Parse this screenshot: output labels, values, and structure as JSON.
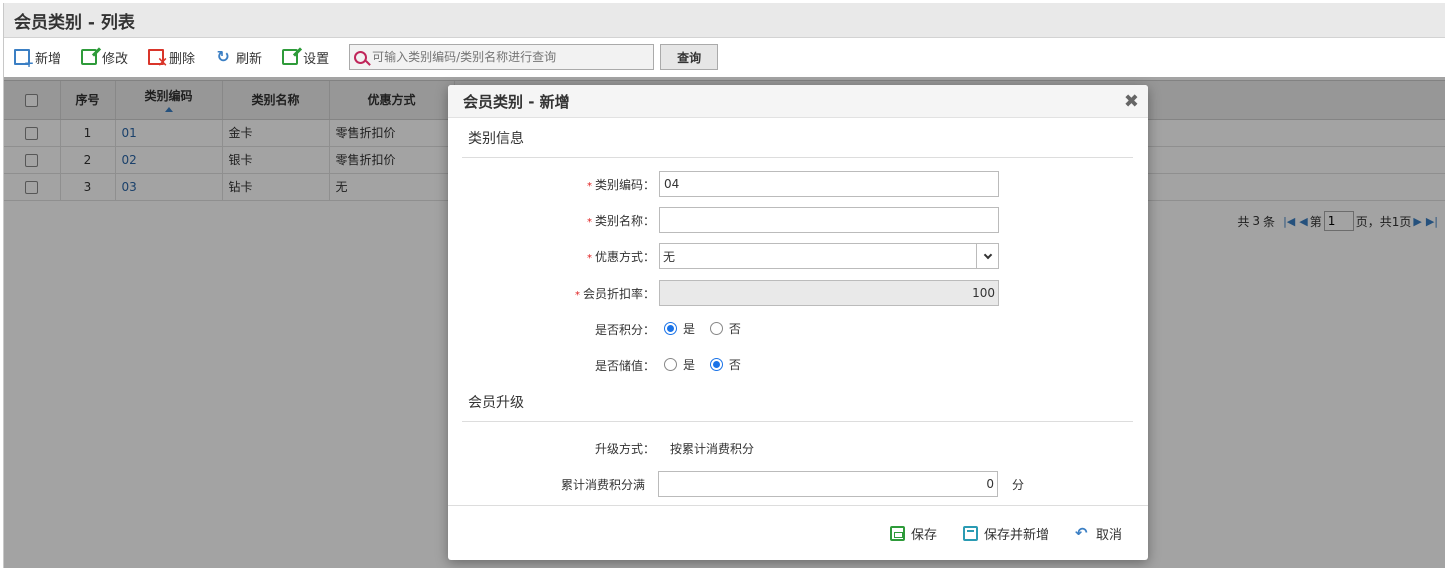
{
  "page": {
    "title": "会员类别 - 列表"
  },
  "toolbar": {
    "add": "新增",
    "edit": "修改",
    "delete": "删除",
    "refresh": "刷新",
    "settings": "设置",
    "search_placeholder": "可输入类别编码/类别名称进行查询",
    "search_button": "查询"
  },
  "grid": {
    "columns": {
      "index": "序号",
      "code": "类别编码",
      "name": "类别名称",
      "discount": "优惠方式"
    },
    "rows": [
      {
        "index": "1",
        "code": "01",
        "name": "金卡",
        "discount": "零售折扣价"
      },
      {
        "index": "2",
        "code": "02",
        "name": "银卡",
        "discount": "零售折扣价"
      },
      {
        "index": "3",
        "code": "03",
        "name": "钻卡",
        "discount": "无"
      }
    ]
  },
  "pager": {
    "total_prefix": "共",
    "total": "3",
    "total_suffix": "条",
    "page_prefix": "第",
    "current_page": "1",
    "page_suffix": "页，共1页"
  },
  "dialog": {
    "title": "会员类别 - 新增",
    "section_info": "类别信息",
    "code_label": "类别编码：",
    "code_value": "04",
    "name_label": "类别名称：",
    "name_value": "",
    "discount_label": "优惠方式：",
    "discount_value": "无",
    "rate_label": "会员折扣率：",
    "rate_value": "100",
    "points_label": "是否积分：",
    "points_yes": "是",
    "points_no": "否",
    "points_selected": "是",
    "stored_label": "是否储值：",
    "stored_yes": "是",
    "stored_no": "否",
    "stored_selected": "否",
    "section_upgrade": "会员升级",
    "upgrade_method_label": "升级方式：",
    "upgrade_method_value": "按累计消费积分",
    "accum_label": "累计消费积分满",
    "accum_value": "0",
    "accum_unit": "分",
    "save": "保存",
    "save_add": "保存并新增",
    "cancel": "取消"
  },
  "colors": {
    "accent": "#1a73e8",
    "link": "#2b66a8",
    "required": "#e02020"
  }
}
